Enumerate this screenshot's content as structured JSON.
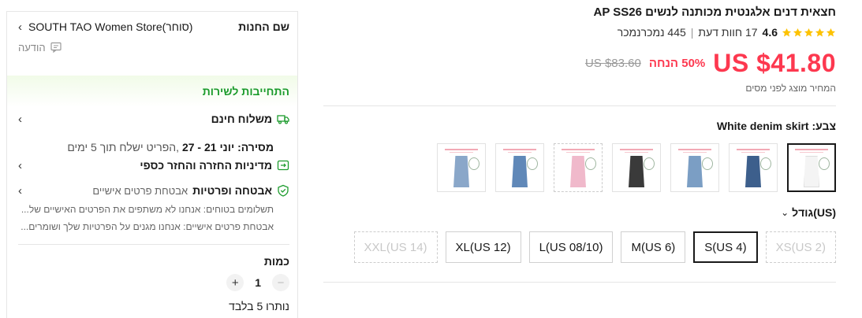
{
  "product": {
    "title": "חצאית דנים אלגנטית מכותנה לנשים AP SS26",
    "rating": {
      "value": "4.6",
      "stars": 5,
      "reviews_text": "17 חוות דעת",
      "sold_text": "445 נמכרנמכר"
    },
    "price": {
      "current": "US $41.80",
      "discount": "50% הנחה",
      "original": "US $83.60"
    },
    "tax_note": "המחיר מוצג לפני מסים",
    "color": {
      "label": "צבע:",
      "selected_value": "White denim skirt",
      "swatches": [
        {
          "name": "white",
          "color": "#f4f4f4",
          "selected": true,
          "disabled": false
        },
        {
          "name": "dark-blue",
          "color": "#3d5f8c",
          "selected": false,
          "disabled": false
        },
        {
          "name": "light-blue",
          "color": "#7b9ec4",
          "selected": false,
          "disabled": false
        },
        {
          "name": "black",
          "color": "#3a3a3a",
          "selected": false,
          "disabled": false
        },
        {
          "name": "pink",
          "color": "#f0b9cb",
          "selected": false,
          "disabled": true
        },
        {
          "name": "medium-blue",
          "color": "#6088b8",
          "selected": false,
          "disabled": false
        },
        {
          "name": "washed-blue",
          "color": "#8aa7c9",
          "selected": false,
          "disabled": false
        }
      ]
    },
    "size": {
      "label": "גודל(US)",
      "options": [
        {
          "label": "XS(US 2)",
          "selected": false,
          "disabled": true
        },
        {
          "label": "S(US 4)",
          "selected": true,
          "disabled": false
        },
        {
          "label": "M(US 6)",
          "selected": false,
          "disabled": false
        },
        {
          "label": "L(US 08/10)",
          "selected": false,
          "disabled": false
        },
        {
          "label": "XL(US 12)",
          "selected": false,
          "disabled": false
        },
        {
          "label": "XXL(US 14)",
          "selected": false,
          "disabled": true
        }
      ]
    }
  },
  "store": {
    "key_label": "שם החנות",
    "name": "SOUTH TAO Women Store(סוחר)",
    "message_label": "הודעה"
  },
  "service": {
    "commitment_label": "התחייבות לשירות",
    "shipping": {
      "title": "משלוח חינם",
      "delivery_prefix": "מסירה:",
      "delivery_dates": "יוני 21 - 27",
      "delivery_note": ",הפריט ישלח תוך 5 ימים"
    },
    "returns": {
      "title": "מדיניות החזרה והחזר כספי"
    },
    "security": {
      "title": "אבטחה ופרטיות",
      "subtitle": "אבטחת פרטים אישיים",
      "line1": "תשלומים בטוחים: אנחנו לא משתפים את הפרטים האישיים של...",
      "line2": "אבטחת פרטים אישיים: אנחנו מגנים על הפרטיות שלך ושומרים..."
    }
  },
  "quantity": {
    "label": "כמות",
    "value": "1",
    "minus": "−",
    "plus": "+",
    "stock_note": "נותרו 5 בלבד"
  },
  "colors": {
    "price_red": "#fd384f",
    "service_green": "#1c9b2d",
    "star_yellow": "#fdc200"
  }
}
